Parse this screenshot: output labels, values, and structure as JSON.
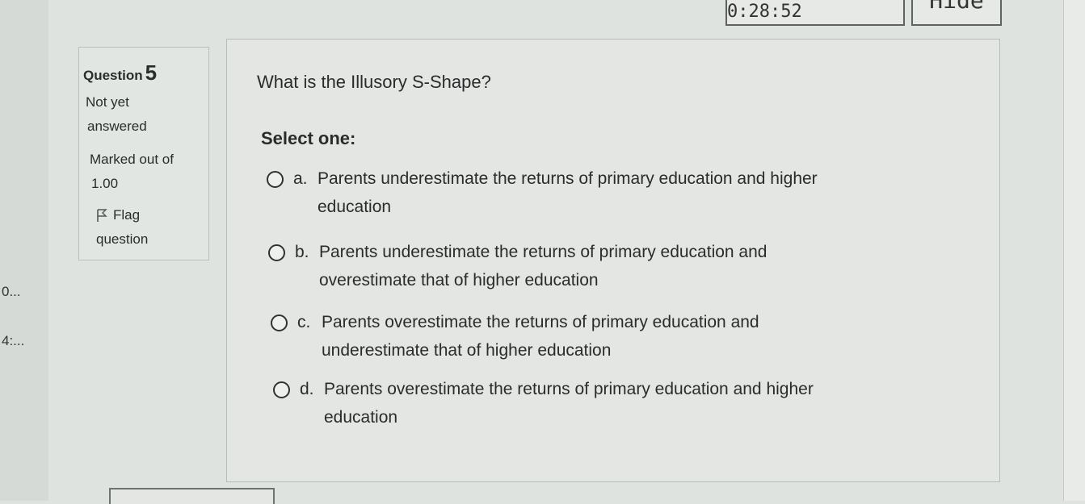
{
  "timer": {
    "label": "Time left 0:28:52"
  },
  "hide_button": {
    "label": "Hide"
  },
  "left_fragments": {
    "f1": "0...",
    "f2": "4:..."
  },
  "question_info": {
    "title": "Question",
    "number": "5",
    "state_line1": "Not yet",
    "state_line2": "answered",
    "mark_line1": "Marked out of",
    "mark_line2": "1.00",
    "flag_line1": "Flag",
    "flag_line2": "question"
  },
  "question": {
    "text": "What is the Illusory S-Shape?",
    "prompt": "Select one:",
    "options": [
      {
        "letter": "a.",
        "line1": "Parents underestimate the returns of primary education and higher",
        "line2": "education"
      },
      {
        "letter": "b.",
        "line1": "Parents underestimate the returns of primary education and",
        "line2": "overestimate that of higher education"
      },
      {
        "letter": "c.",
        "line1": "Parents overestimate the returns of primary education and",
        "line2": "underestimate that of higher education"
      },
      {
        "letter": "d.",
        "line1": "Parents overestimate the returns of primary education and higher",
        "line2": "education"
      }
    ]
  }
}
